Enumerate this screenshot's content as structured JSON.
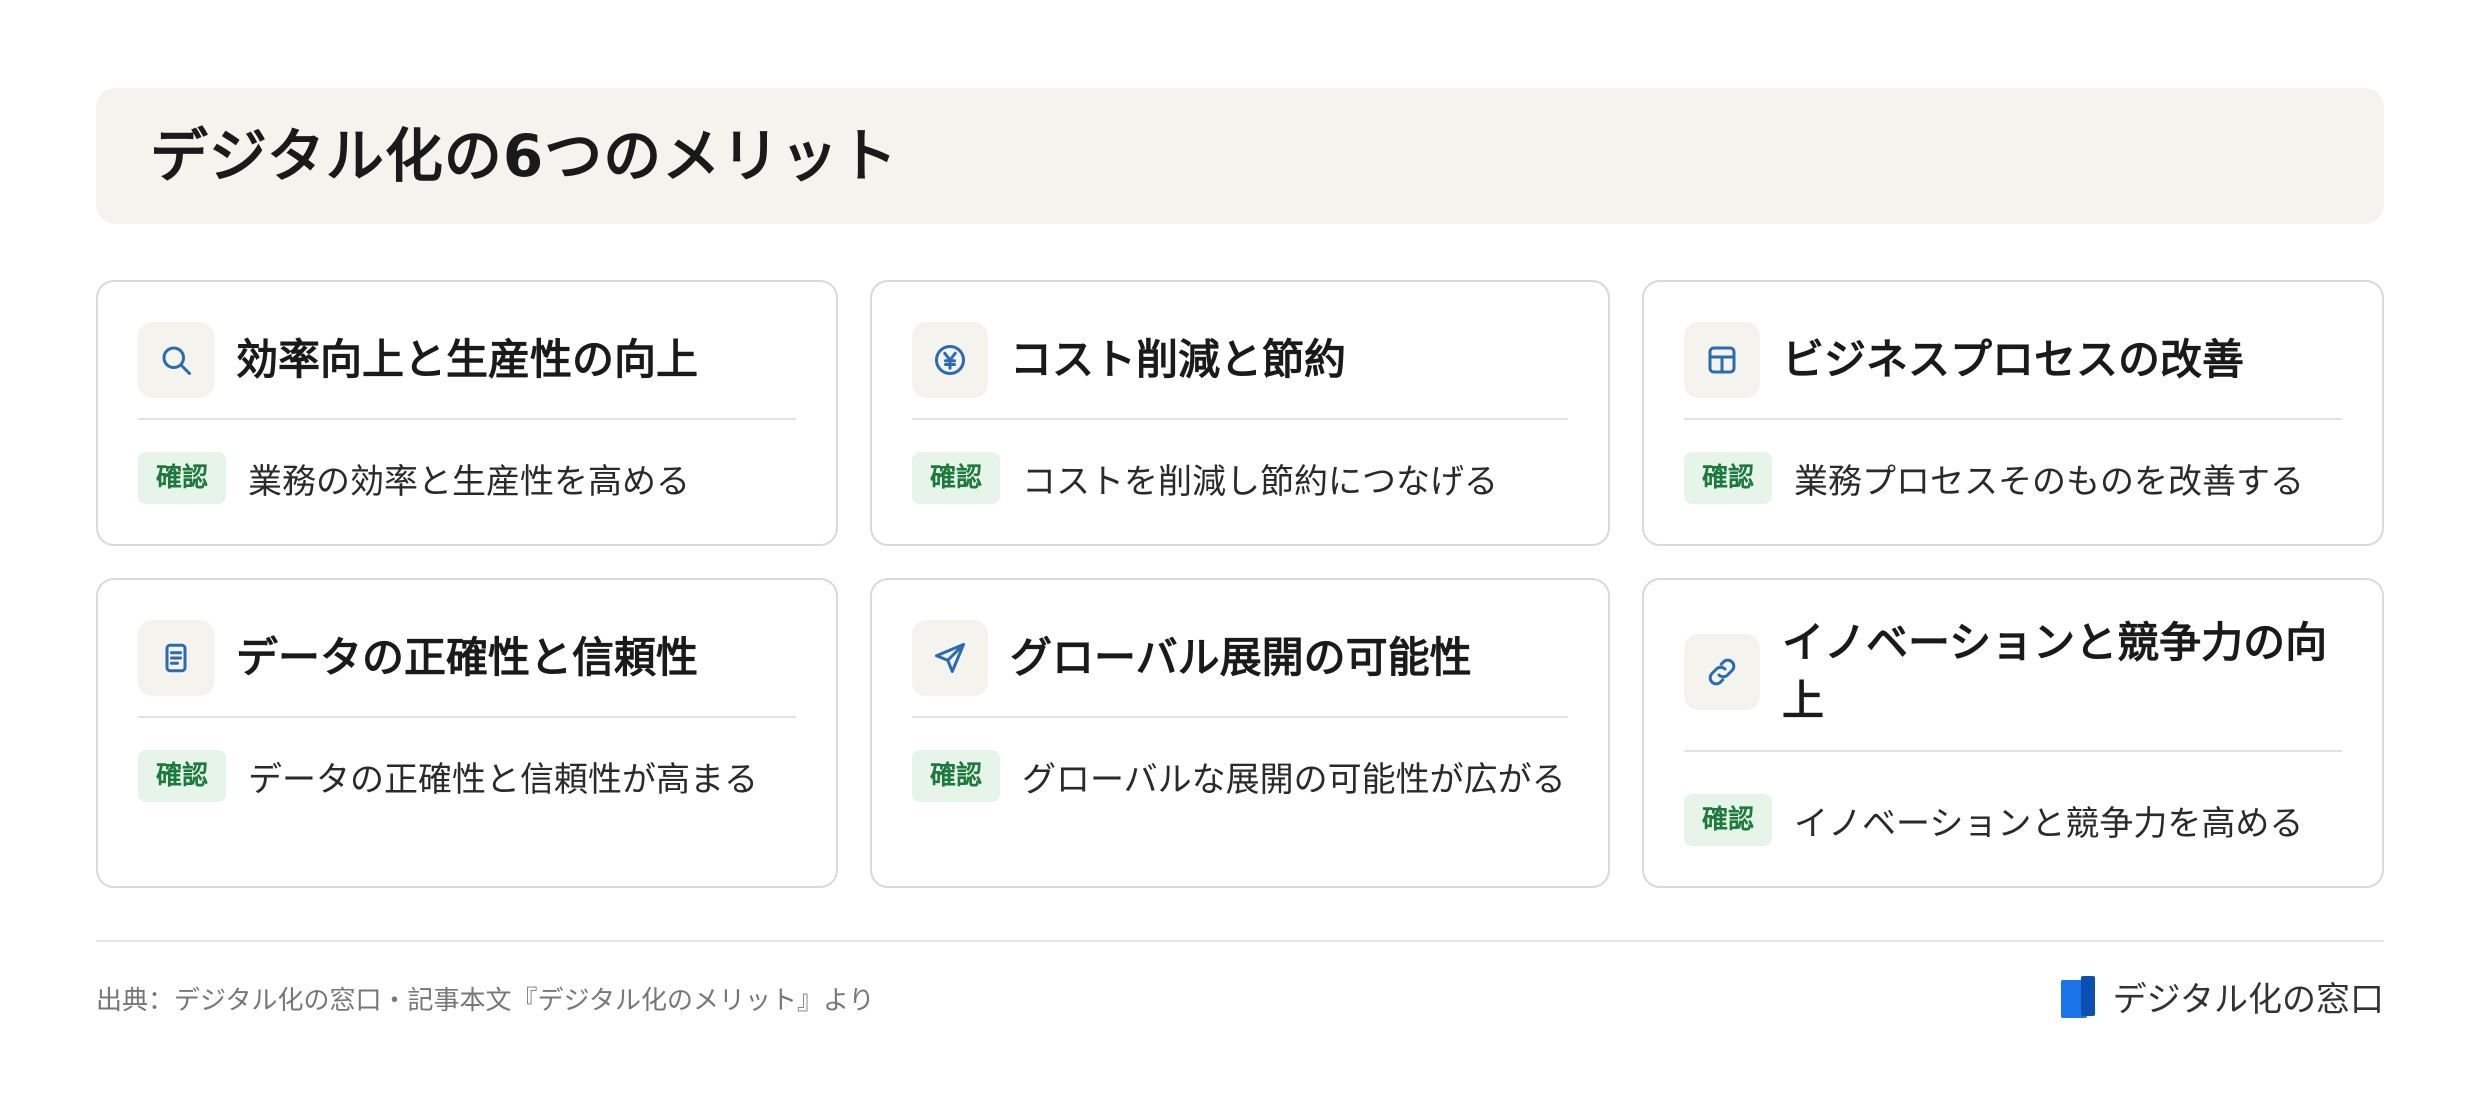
{
  "title": "デジタル化の6つのメリット",
  "cards": [
    {
      "icon": "search-icon",
      "title": "効率向上と生産性の向上",
      "badge": "確認",
      "desc": "業務の効率と生産性を高める"
    },
    {
      "icon": "yen-icon",
      "title": "コスト削減と節約",
      "badge": "確認",
      "desc": "コストを削減し節約につなげる"
    },
    {
      "icon": "layout-icon",
      "title": "ビジネスプロセスの改善",
      "badge": "確認",
      "desc": "業務プロセスそのものを改善する"
    },
    {
      "icon": "document-icon",
      "title": "データの正確性と信頼性",
      "badge": "確認",
      "desc": "データの正確性と信頼性が高まる"
    },
    {
      "icon": "send-icon",
      "title": "グローバル展開の可能性",
      "badge": "確認",
      "desc": "グローバルな展開の可能性が広がる"
    },
    {
      "icon": "link-icon",
      "title": "イノベーションと競争力の向上",
      "badge": "確認",
      "desc": "イノベーションと競争力を高める"
    }
  ],
  "footer": {
    "source": "出典：デジタル化の窓口・記事本文『デジタル化のメリット』より",
    "logo_text": "デジタル化の窓口"
  },
  "colors": {
    "accent": "#2b6cb0",
    "badge_bg": "#e6f4ea",
    "badge_text": "#1e7a3c",
    "header_bg": "#f5f3ee",
    "logo_blue": "#1a73e8"
  }
}
